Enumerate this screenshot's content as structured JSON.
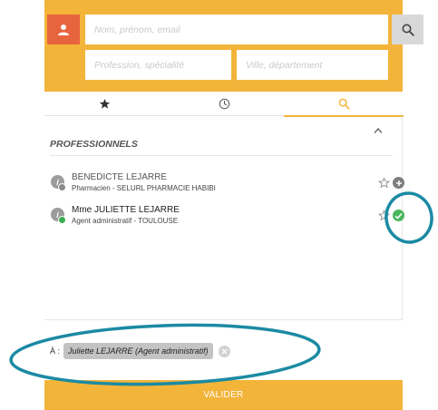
{
  "search": {
    "name_placeholder": "Nom, prénom, email",
    "profession_placeholder": "Profession, spécialité",
    "city_placeholder": "Ville, département"
  },
  "tabs": [
    {
      "icon": "star-icon",
      "active": false
    },
    {
      "icon": "clock-icon",
      "active": false
    },
    {
      "icon": "search-icon",
      "active": true
    }
  ],
  "results": {
    "section_title": "PROFESSIONNELS",
    "items": [
      {
        "name": "BENEDICTE LEJARRE",
        "subtitle": "Pharmacien - SELURL PHARMACIE HABIBI",
        "status_color": "#8a8a8a",
        "action": "add"
      },
      {
        "name": "Mme JULIETTE LEJARRE",
        "subtitle": "Agent administratif - TOULOUSE",
        "status_color": "#3aad4e",
        "action": "selected"
      }
    ]
  },
  "recipient": {
    "prefix": "À :",
    "chip_label": "Juliette LEJARRE (Agent administratif)"
  },
  "validate_label": "VALIDER",
  "colors": {
    "accent": "#f3b43a",
    "user_button": "#e8643f",
    "annotation_ring": "#1b8aa3",
    "check": "#49b65a"
  }
}
